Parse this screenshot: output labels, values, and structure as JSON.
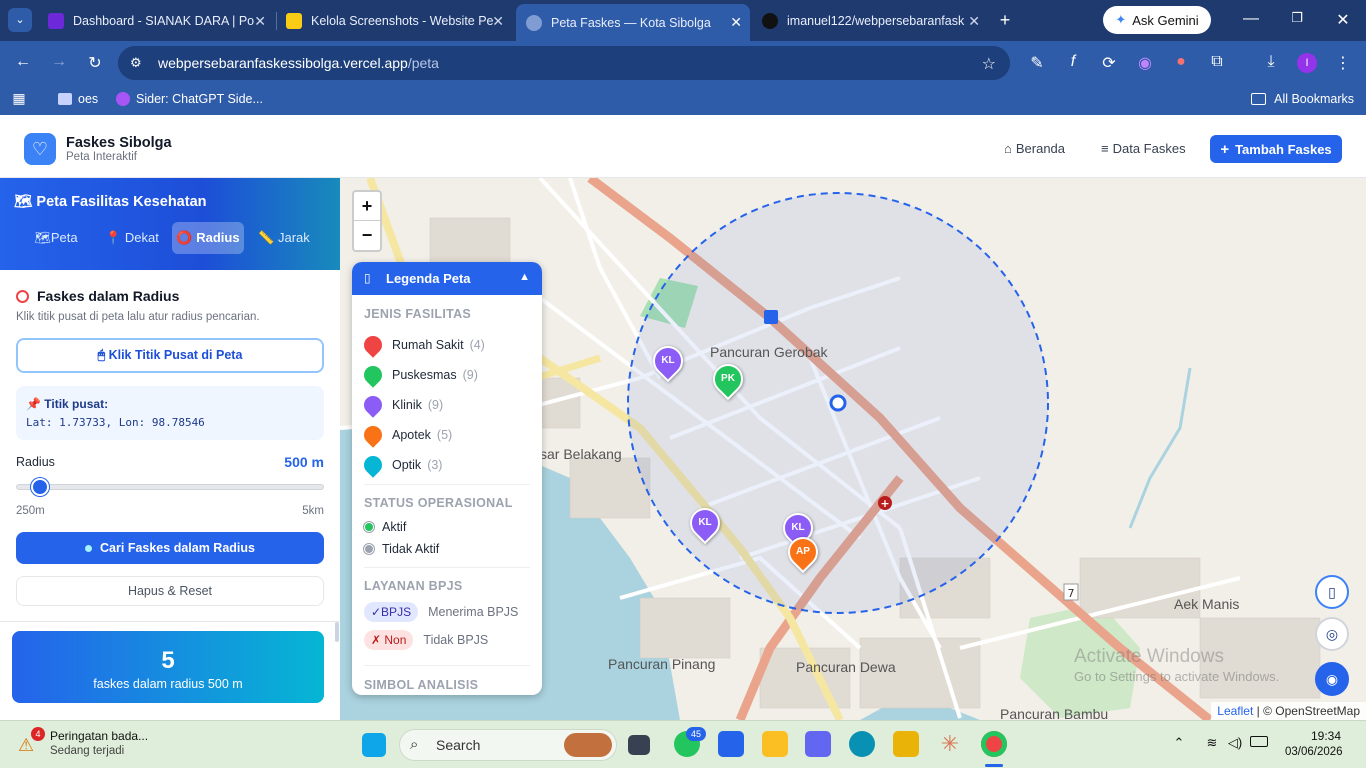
{
  "browser": {
    "tabs": [
      {
        "title": "Dashboard - SIANAK DARA | Po",
        "active": false
      },
      {
        "title": "Kelola Screenshots - Website Pe",
        "active": false
      },
      {
        "title": "Peta Faskes — Kota Sibolga",
        "active": true
      },
      {
        "title": "imanuel122/webpersebaranfask",
        "active": false
      }
    ],
    "ask_gemini": "Ask Gemini",
    "url_host": "webpersebaranfaskessibolga.vercel.app",
    "url_path": "/peta",
    "bookmarks": [
      "oes",
      "Sider: ChatGPT Side..."
    ],
    "all_bookmarks": "All Bookmarks",
    "profile_initial": "I"
  },
  "app": {
    "title": "Faskes Sibolga",
    "subtitle": "Peta Interaktif",
    "nav": {
      "home": "Beranda",
      "data": "Data Faskes",
      "add": "Tambah Faskes"
    }
  },
  "sidebar": {
    "title": "🗺 Peta Fasilitas Kesehatan",
    "modes": [
      "🗺Peta",
      "📍 Dekat",
      "⭕ Radius",
      "📏 Jarak"
    ],
    "active_mode": 2,
    "section_title": "Faskes dalam Radius",
    "section_desc": "Klik titik pusat di peta lalu atur radius pencarian.",
    "pick_center_button": "🖱 Klik Titik Pusat di Peta",
    "center_label": "📌 Titik pusat:",
    "center_value": "Lat: 1.73733, Lon: 98.78546",
    "radius_label": "Radius",
    "radius_value": "500 m",
    "radius_min": "250m",
    "radius_max": "5km",
    "radius_fraction": 0.05,
    "search_button": "Cari Faskes dalam Radius",
    "reset_button": "Hapus & Reset",
    "result_count": "5",
    "result_text": "faskes dalam radius 500 m"
  },
  "legend": {
    "title": "Legenda Peta",
    "types_header": "JENIS FASILITAS",
    "types": [
      {
        "label": "Rumah Sakit",
        "count": "(4)",
        "color": "#ef4444"
      },
      {
        "label": "Puskesmas",
        "count": "(9)",
        "color": "#22c55e"
      },
      {
        "label": "Klinik",
        "count": "(9)",
        "color": "#8b5cf6"
      },
      {
        "label": "Apotek",
        "count": "(5)",
        "color": "#f97316"
      },
      {
        "label": "Optik",
        "count": "(3)",
        "color": "#06b6d4"
      }
    ],
    "status_header": "STATUS OPERASIONAL",
    "status": [
      {
        "label": "Aktif",
        "color": "#22c55e"
      },
      {
        "label": "Tidak Aktif",
        "color": "#9ca3af"
      }
    ],
    "bpjs_header": "LAYANAN BPJS",
    "bpjs": [
      {
        "badge": "✓BPJS",
        "label": "Menerima BPJS"
      },
      {
        "badge": "✗ Non",
        "label": "Tidak BPJS"
      }
    ],
    "symbol_header": "SIMBOL ANALISIS"
  },
  "map": {
    "zoom_in": "+",
    "zoom_out": "−",
    "places": [
      "Pancuran Gerobak",
      "sar Belakang",
      "Pancuran Pinang",
      "Pancuran Dewa",
      "Aek Manis",
      "Pancuran Bambu"
    ],
    "markers": [
      {
        "code": "KL",
        "color": "#8b5cf6"
      },
      {
        "code": "PK",
        "color": "#22c55e"
      },
      {
        "code": "KL",
        "color": "#8b5cf6"
      },
      {
        "code": "KL",
        "color": "#8b5cf6"
      },
      {
        "code": "AP",
        "color": "#f97316"
      }
    ],
    "road_marker": "7",
    "attribution_leaflet": "Leaflet",
    "attribution_osm": "| © OpenStreetMap",
    "watermark_line1": "Activate Windows",
    "watermark_line2": "Go to Settings to activate Windows."
  },
  "taskbar": {
    "notif_title": "Peringatan bada...",
    "notif_sub": "Sedang terjadi",
    "notif_badge": "4",
    "search_placeholder": "Search",
    "whatsapp_badge": "45",
    "time": "19:34",
    "date": "03/06/2026"
  }
}
